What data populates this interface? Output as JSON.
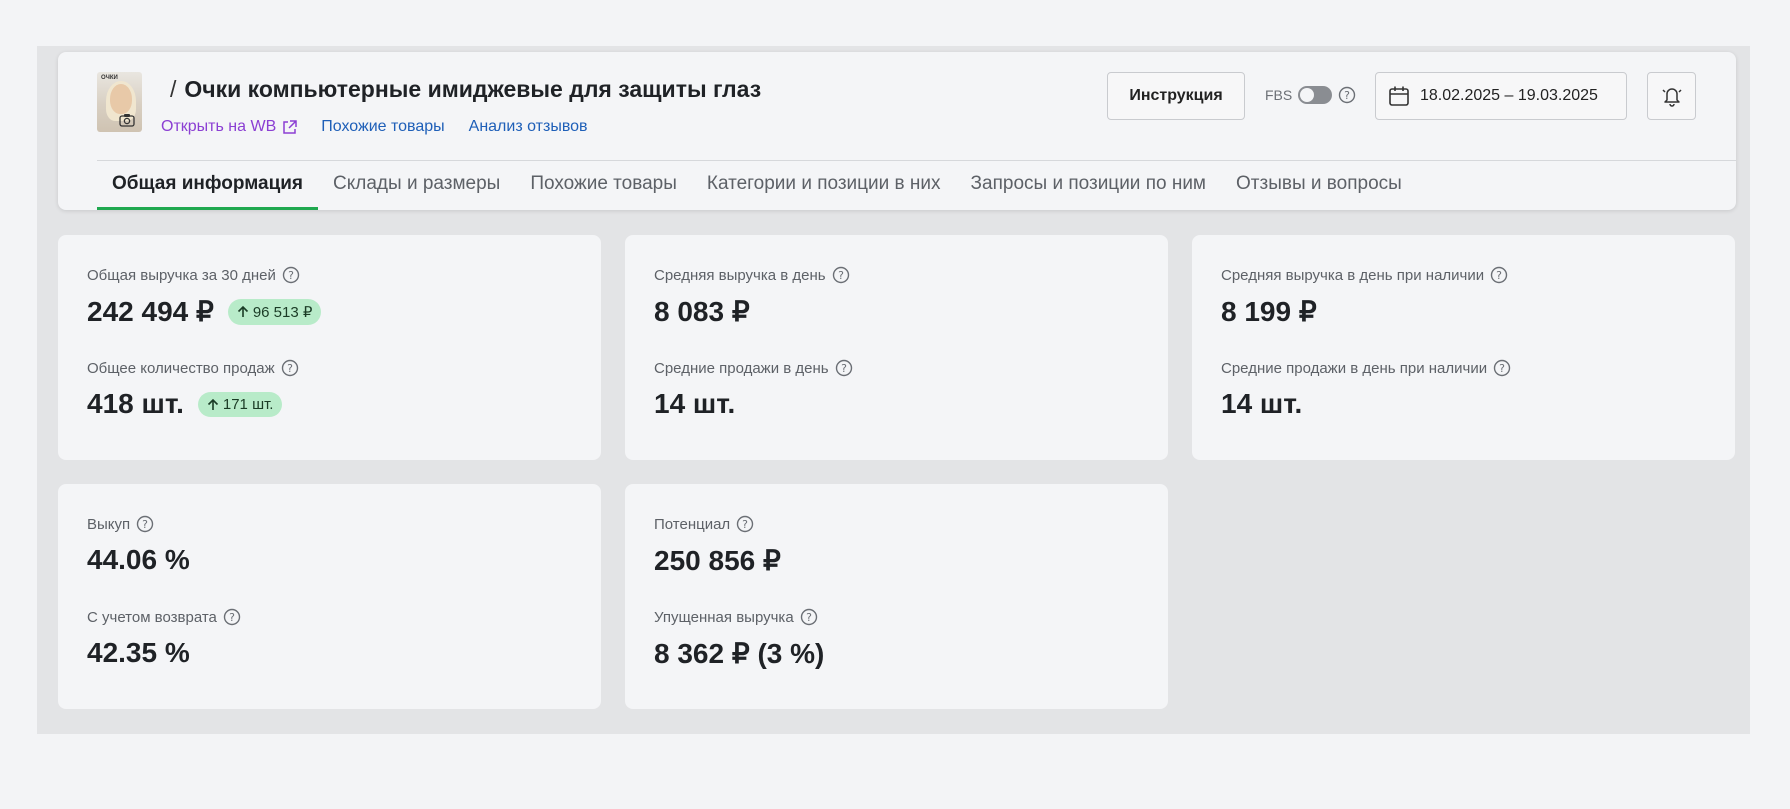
{
  "header": {
    "slash": "/",
    "product_title": "Очки компьютерные имиджевые для защиты глаз",
    "thumbnail_text": "ОЧКИ",
    "links": {
      "open_wb": "Открыть на WB",
      "similar": "Похожие товары",
      "reviews_analysis": "Анализ отзывов"
    },
    "instruction_button": "Инструкция",
    "fbs_label": "FBS",
    "date_range": "18.02.2025 – 19.03.2025"
  },
  "tabs": [
    {
      "label": "Общая информация",
      "active": true
    },
    {
      "label": "Склады и размеры",
      "active": false
    },
    {
      "label": "Похожие товары",
      "active": false
    },
    {
      "label": "Категории и позиции в них",
      "active": false
    },
    {
      "label": "Запросы и позиции по ним",
      "active": false
    },
    {
      "label": "Отзывы и вопросы",
      "active": false
    }
  ],
  "cards": {
    "revenue": {
      "total_label": "Общая выручка за 30 дней",
      "total_value": "242 494 ₽",
      "total_delta": "96 513 ₽",
      "sales_label": "Общее количество продаж",
      "sales_value": "418 шт.",
      "sales_delta": "171 шт."
    },
    "average": {
      "rev_label": "Средняя выручка в день",
      "rev_value": "8 083 ₽",
      "sales_label": "Средние продажи в день",
      "sales_value": "14 шт."
    },
    "average_stock": {
      "rev_label": "Средняя выручка в день при наличии",
      "rev_value": "8 199 ₽",
      "sales_label": "Средние продажи в день при наличии",
      "sales_value": "14 шт."
    },
    "buyout": {
      "label": "Выкуп",
      "value": "44.06 %",
      "returns_label": "С учетом возврата",
      "returns_value": "42.35 %"
    },
    "potential": {
      "label": "Потенциал",
      "value": "250 856 ₽",
      "lost_label": "Упущенная выручка",
      "lost_value": "8 362 ₽ (3 %)"
    }
  },
  "colors": {
    "accent_green": "#1fa84f",
    "delta_bg": "#b8ebc9",
    "link_purple": "#8b3fd3",
    "link_blue": "#1e5fb8"
  }
}
